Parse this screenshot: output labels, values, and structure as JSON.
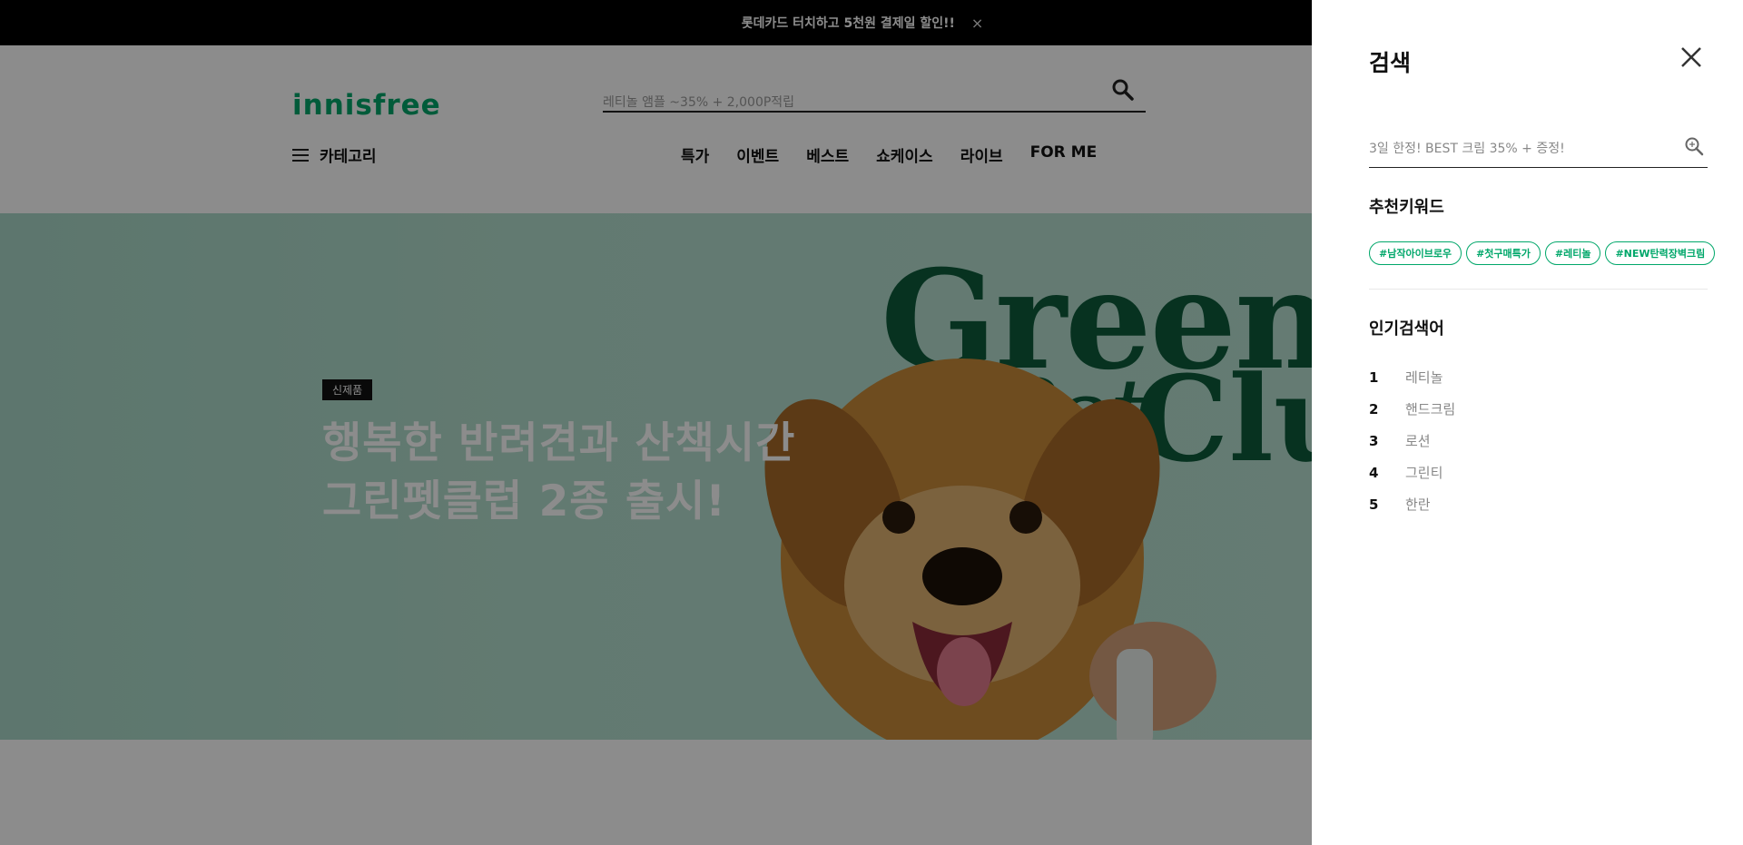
{
  "topbar": {
    "promo": "롯데카드 터치하고 5천원 결제일 할인!!",
    "close": "×"
  },
  "header": {
    "logo": "innisfree",
    "search_placeholder": "레티놀 앰플 ~35% + 2,000P적립",
    "category_label": "카테고리",
    "nav_links": [
      "특가",
      "이벤트",
      "베스트",
      "쇼케이스",
      "라이브",
      "FOR ME"
    ]
  },
  "hero": {
    "badge": "신제품",
    "headline_line1": "행복한 반려견과 산책시간",
    "headline_line2": "그린펫클럽 2종 출시!",
    "brand_word1": "Green",
    "brand_word2": "Pet",
    "brand_word3": "Club"
  },
  "panel": {
    "title": "검색",
    "search_placeholder": "3일 한정! BEST 크림 35% + 증정!",
    "recommended_title": "추천키워드",
    "tags": [
      "#남작아이브로우",
      "#첫구매특가",
      "#레티놀",
      "#NEW탄력장벽크림"
    ],
    "popular_title": "인기검색어",
    "popular": [
      {
        "rank": "1",
        "keyword": "레티놀"
      },
      {
        "rank": "2",
        "keyword": "핸드크림"
      },
      {
        "rank": "3",
        "keyword": "로션"
      },
      {
        "rank": "4",
        "keyword": "그린티"
      },
      {
        "rank": "5",
        "keyword": "한란"
      }
    ]
  },
  "colors": {
    "brand_green": "#00a76a",
    "dark_green": "#0d5b3b",
    "overlay": "rgba(0,0,0,0.45)"
  }
}
